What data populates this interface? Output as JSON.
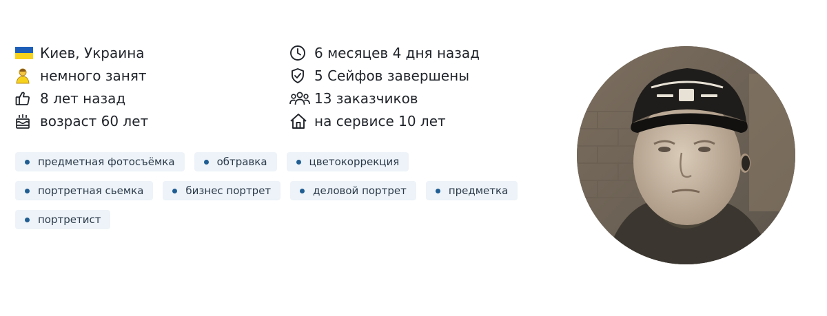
{
  "profile": {
    "location": "Киев, Украина",
    "availability": "немного занят",
    "registered": "8 лет назад",
    "age": "возраст 60 лет",
    "last_seen": "6 месяцев 4 дня назад",
    "safe_deals": "5 Сейфов завершены",
    "clients": "13 заказчиков",
    "on_service": "на сервисе 10 лет"
  },
  "icons": {
    "location": "ukraine-flag-icon",
    "availability": "person-status-icon",
    "registered": "thumbs-up-icon",
    "age": "birthday-cake-icon",
    "last_seen": "clock-icon",
    "safe_deals": "shield-check-icon",
    "clients": "users-group-icon",
    "on_service": "home-icon"
  },
  "tags": [
    [
      "предметная фотосъёмка",
      "обтравка",
      "цветокоррекция"
    ],
    [
      "портретная сьемка",
      "бизнес портрет",
      "деловой портрет",
      "предметка"
    ],
    [
      "портретист"
    ]
  ],
  "colors": {
    "tag_background": "#edf3f8",
    "tag_dot": "#1f5d92",
    "text": "#1f2329",
    "flag_blue": "#1d5fb8",
    "flag_yellow": "#f7d21c"
  }
}
